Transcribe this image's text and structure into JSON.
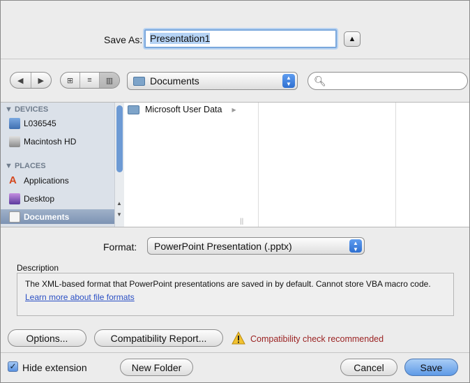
{
  "save_as": {
    "label": "Save As:",
    "filename": "Presentation1"
  },
  "toolbar": {
    "back_icon": "back-arrow-icon",
    "forward_icon": "forward-arrow-icon",
    "view_modes": [
      "icon-view-icon",
      "list-view-icon",
      "column-view-icon"
    ],
    "location": "Documents",
    "search_placeholder": ""
  },
  "sidebar": {
    "devices_header": "DEVICES",
    "devices": [
      {
        "label": "L036545",
        "icon": "computer-icon"
      },
      {
        "label": "Macintosh HD",
        "icon": "hard-drive-icon"
      }
    ],
    "places_header": "PLACES",
    "places": [
      {
        "label": "Applications",
        "icon": "applications-icon"
      },
      {
        "label": "Desktop",
        "icon": "desktop-icon"
      },
      {
        "label": "Documents",
        "icon": "documents-icon",
        "selected": true
      }
    ]
  },
  "browser": {
    "items": [
      {
        "label": "Microsoft User Data",
        "icon": "folder-icon"
      }
    ]
  },
  "format": {
    "label": "Format:",
    "value": "PowerPoint Presentation (.pptx)"
  },
  "description": {
    "label": "Description",
    "text": "The XML-based format that PowerPoint presentations are saved in by default. Cannot store VBA macro code.",
    "link": "Learn more about file formats"
  },
  "buttons": {
    "options": "Options...",
    "compat_report": "Compatibility Report...",
    "new_folder": "New Folder",
    "cancel": "Cancel",
    "save": "Save"
  },
  "warning": {
    "text": "Compatibility check recommended"
  },
  "hide_extension": {
    "label": "Hide extension",
    "checked": true
  },
  "colors": {
    "accent": "#5e9ae6",
    "warning_text": "#9b2323",
    "link": "#2a4fc4"
  }
}
